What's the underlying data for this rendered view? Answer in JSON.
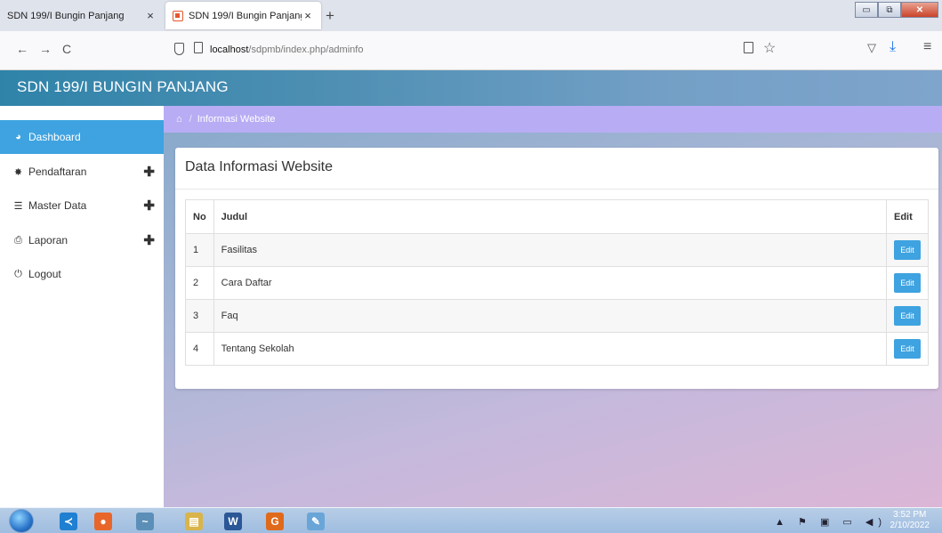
{
  "browser": {
    "tabs": [
      {
        "title": "SDN 199/I Bungin Panjang",
        "close": "×",
        "active": false
      },
      {
        "title": "SDN 199/I Bungin Panjang",
        "close": "×",
        "active": true
      }
    ],
    "new_tab": "+",
    "url_host": "localhost",
    "url_path": "/sdpmb/index.php/adminfo",
    "nav": {
      "back": "←",
      "forward": "→",
      "reload": "C"
    },
    "window_buttons": {
      "minimize": "▭",
      "maximize": "⧉",
      "close": "✕"
    }
  },
  "header": {
    "brand": "SDN 199/I BUNGIN PANJANG"
  },
  "sidebar": {
    "items": [
      {
        "label": "Dashboard",
        "icon": "dashboard-icon",
        "glyph": "◕",
        "active": true,
        "expandable": false
      },
      {
        "label": "Pendaftaran",
        "icon": "gear-icon",
        "glyph": "✸",
        "active": false,
        "expandable": true
      },
      {
        "label": "Master Data",
        "icon": "database-icon",
        "glyph": "☰",
        "active": false,
        "expandable": true
      },
      {
        "label": "Laporan",
        "icon": "printer-icon",
        "glyph": "⎙",
        "active": false,
        "expandable": true
      },
      {
        "label": "Logout",
        "icon": "power-icon",
        "glyph": "⏻",
        "active": false,
        "expandable": false
      }
    ],
    "expand_glyph": "✚"
  },
  "breadcrumb": {
    "home_glyph": "⌂",
    "separator": "/",
    "current": "Informasi Website"
  },
  "card": {
    "title": "Data Informasi Website",
    "columns": [
      "No",
      "Judul",
      "Edit"
    ],
    "rows": [
      {
        "no": "1",
        "judul": "Fasilitas",
        "edit": "Edit"
      },
      {
        "no": "2",
        "judul": "Cara Daftar",
        "edit": "Edit"
      },
      {
        "no": "3",
        "judul": "Faq",
        "edit": "Edit"
      },
      {
        "no": "4",
        "judul": "Tentang Sekolah",
        "edit": "Edit"
      }
    ]
  },
  "taskbar": {
    "apps": [
      {
        "name": "vscode-icon",
        "color": "#1f7fd1",
        "glyph": "≺"
      },
      {
        "name": "firefox-icon",
        "color": "#e8662a",
        "glyph": "●"
      },
      {
        "name": "dolphin-icon",
        "color": "#5b8fb8",
        "glyph": "~"
      },
      {
        "name": "file-explorer-icon",
        "color": "#d9b44a",
        "glyph": "▤"
      },
      {
        "name": "word-icon",
        "color": "#2b5797",
        "glyph": "W"
      },
      {
        "name": "pdf-icon",
        "color": "#e06a1b",
        "glyph": "G"
      },
      {
        "name": "paint-icon",
        "color": "#6aa5d8",
        "glyph": "✎"
      }
    ],
    "tray": "▲ ⚑ ▣ ▭ ◀)",
    "time": "3:52 PM",
    "date": "2/10/2022"
  }
}
